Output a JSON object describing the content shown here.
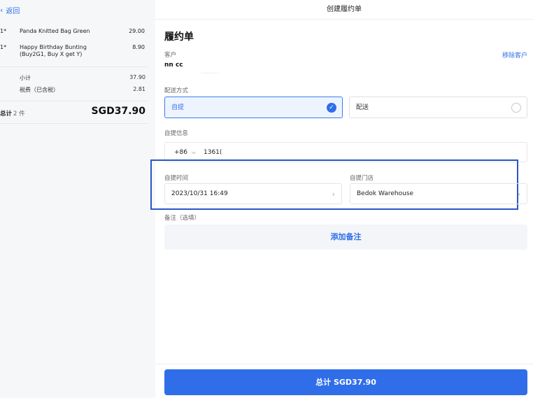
{
  "left": {
    "back_label": "返回",
    "items": [
      {
        "qty": "1*",
        "name": "Panda Knitted Bag Green",
        "price": "29.00"
      },
      {
        "qty": "1*",
        "name": "Happy Birthday Bunting (Buy2G1, Buy X get Y)",
        "price": "8.90"
      }
    ],
    "subtotal_label": "小计",
    "subtotal_value": "37.90",
    "tax_label": "税费（已含税）",
    "tax_value": "2.81",
    "total_label": "总计",
    "total_count": "2 件",
    "total_value": "SGD37.90"
  },
  "right": {
    "header_title": "创建履约单",
    "page_title": "履约单",
    "customer_label": "客户",
    "remove_customer": "移除客户",
    "customer_name": "nn cc",
    "delivery_method_label": "配送方式",
    "option_pickup": "自提",
    "option_delivery": "配送",
    "pickup_info_label": "自提信息",
    "country_code": "+86",
    "phone_number": "1361(",
    "pickup_time_label": "自提时间",
    "pickup_time_value": "2023/10/31 16:49",
    "pickup_store_label": "自提门店",
    "pickup_store_value": "Bedok Warehouse",
    "note_label": "备注（选填）",
    "add_note_button": "添加备注",
    "submit_label": "总计 SGD37.90"
  },
  "colors": {
    "accent": "#2f6ee8",
    "highlight_box": "#2a56c6",
    "selected_bg": "#eef4ff"
  }
}
